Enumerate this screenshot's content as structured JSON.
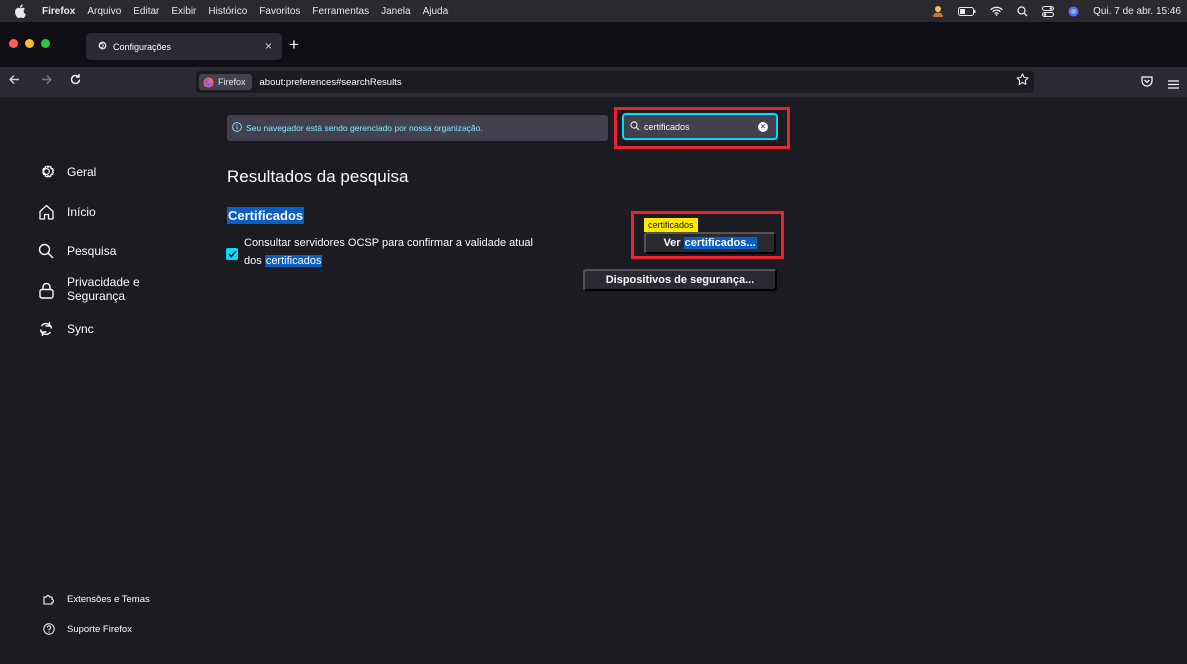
{
  "menubar": {
    "items": [
      "Firefox",
      "Arquivo",
      "Editar",
      "Exibir",
      "Histórico",
      "Favoritos",
      "Ferramentas",
      "Janela",
      "Ajuda"
    ],
    "clock": "Qui. 7 de abr. 15:46"
  },
  "tab": {
    "title": "Configurações",
    "close": "×",
    "new_tab": "+"
  },
  "navbar": {
    "identity_label": "Firefox",
    "url": "about:preferences#searchResults"
  },
  "policy_notice": "Seu navegador está sendo gerenciado por nossa organização.",
  "search": {
    "value": "certificados"
  },
  "sidebar": {
    "items": [
      {
        "label": "Geral"
      },
      {
        "label": "Início"
      },
      {
        "label": "Pesquisa"
      },
      {
        "label": "Privacidade e\nSegurança",
        "line1": "Privacidade e",
        "line2": "Segurança"
      },
      {
        "label": "Sync"
      }
    ],
    "footer": [
      {
        "label": "Extensões e Temas"
      },
      {
        "label": "Suporte Firefox"
      }
    ]
  },
  "main": {
    "results_title": "Resultados da pesquisa",
    "section_title": "Certificados",
    "ocsp_line1": "Consultar servidores OCSP para confirmar a validade atual",
    "ocsp_line2_prefix": "dos",
    "ocsp_line2_match": "certificados",
    "tooltip": "certificados",
    "view_button_prefix": "Ver",
    "view_button_match": "certificados...",
    "devices_button": "Dispositivos de segurança..."
  },
  "colors": {
    "accent": "#00ddff",
    "highlight_box": "#e8242f",
    "match_highlight": "#0b5fc4",
    "tooltip": "#ffe900"
  }
}
